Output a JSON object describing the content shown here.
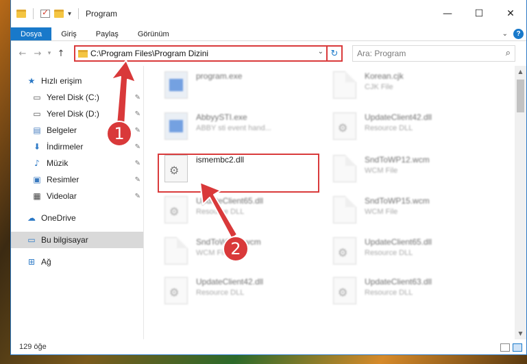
{
  "window": {
    "title": "Program",
    "controls": {
      "minimize": "—",
      "maximize": "☐",
      "close": "✕"
    }
  },
  "ribbon": {
    "tabs": [
      "Dosya",
      "Giriş",
      "Paylaş",
      "Görünüm"
    ],
    "help": "?"
  },
  "navbar": {
    "address": "C:\\Program Files\\Program Dizini",
    "search_placeholder": "Ara: Program"
  },
  "sidebar": {
    "quick_access": "Hızlı erişim",
    "items": [
      {
        "label": "Yerel Disk (C:)",
        "icon": "drive-icon"
      },
      {
        "label": "Yerel Disk (D:)",
        "icon": "drive-icon"
      },
      {
        "label": "Belgeler",
        "icon": "documents-icon"
      },
      {
        "label": "İndirmeler",
        "icon": "download-icon"
      },
      {
        "label": "Müzik",
        "icon": "music-icon"
      },
      {
        "label": "Resimler",
        "icon": "pictures-icon"
      },
      {
        "label": "Videolar",
        "icon": "videos-icon"
      }
    ],
    "onedrive": "OneDrive",
    "this_pc": "Bu bilgisayar",
    "network": "Ağ"
  },
  "files": [
    {
      "name": "program.exe",
      "type": "",
      "kind": "exe"
    },
    {
      "name": "Korean.cjk",
      "type": "CJK File",
      "kind": "doc"
    },
    {
      "name": "AbbyySTI.exe",
      "type": "ABBY sti event hand...",
      "kind": "exe"
    },
    {
      "name": "UpdateClient42.dll",
      "type": "Resource DLL",
      "kind": "dll"
    },
    {
      "name": "ismembc2.dll",
      "type": "",
      "kind": "dll"
    },
    {
      "name": "SndToWP12.wcm",
      "type": "WCM File",
      "kind": "doc"
    },
    {
      "name": "UpdateClient65.dll",
      "type": "Resource DLL",
      "kind": "dll"
    },
    {
      "name": "SndToWP15.wcm",
      "type": "WCM File",
      "kind": "doc"
    },
    {
      "name": "SndToWP15.wcm",
      "type": "WCM File",
      "kind": "doc"
    },
    {
      "name": "UpdateClient65.dll",
      "type": "Resource DLL",
      "kind": "dll"
    },
    {
      "name": "UpdateClient42.dll",
      "type": "Resource DLL",
      "kind": "dll"
    },
    {
      "name": "UpdateClient63.dll",
      "type": "Resource DLL",
      "kind": "dll"
    }
  ],
  "status": {
    "count": "129 öğe"
  },
  "annotations": {
    "step1": "1",
    "step2": "2"
  },
  "colors": {
    "accent": "#1979ca",
    "highlight": "#d9393a"
  }
}
